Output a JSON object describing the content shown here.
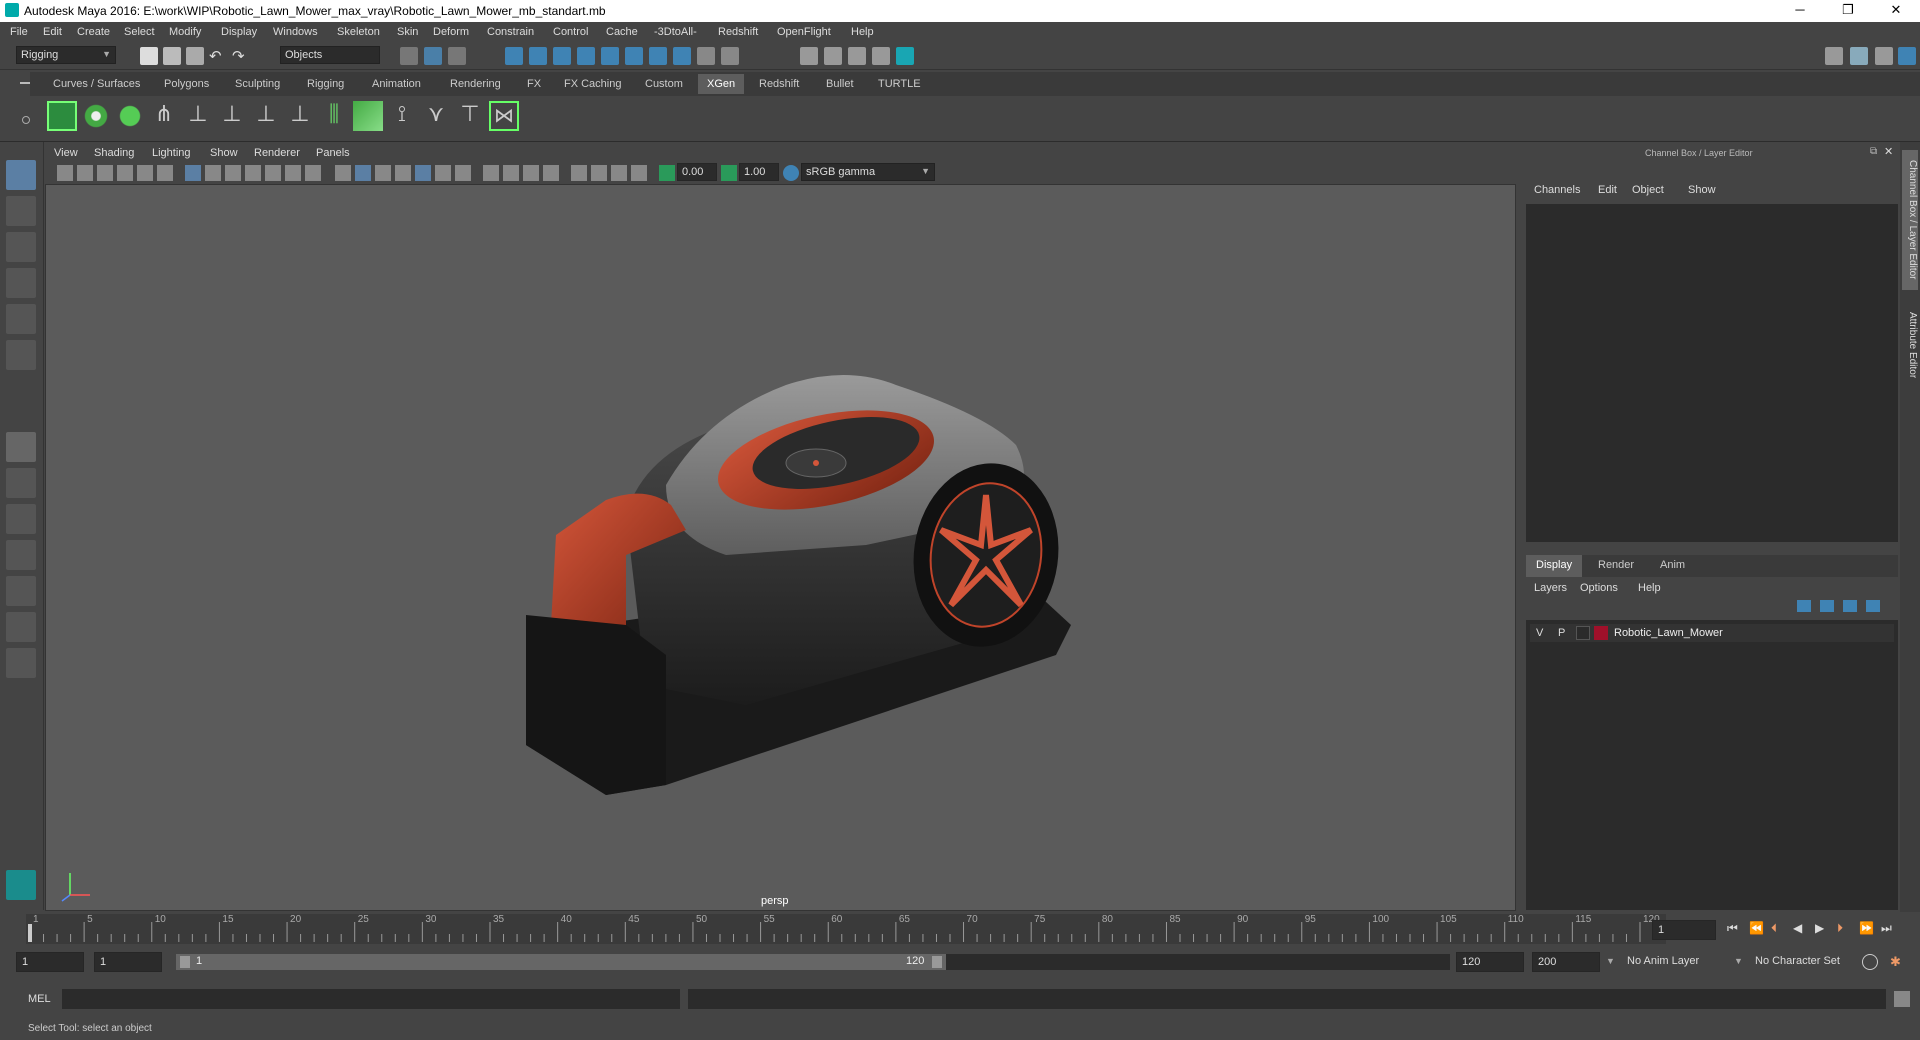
{
  "window": {
    "title": "Autodesk Maya 2016: E:\\work\\WIP\\Robotic_Lawn_Mower_max_vray\\Robotic_Lawn_Mower_mb_standart.mb",
    "minimize": "─",
    "restore": "❐",
    "close": "✕"
  },
  "menubar": [
    "File",
    "Edit",
    "Create",
    "Select",
    "Modify",
    "Display",
    "Windows",
    "Skeleton",
    "Skin",
    "Deform",
    "Constrain",
    "Control",
    "Cache",
    "-3DtoAll-",
    "Redshift",
    "OpenFlight",
    "Help"
  ],
  "statusline": {
    "mode": "Rigging",
    "selection_mode": "Objects"
  },
  "shelf_tabs": [
    "Curves / Surfaces",
    "Polygons",
    "Sculpting",
    "Rigging",
    "Animation",
    "Rendering",
    "FX",
    "FX Caching",
    "Custom",
    "XGen",
    "Redshift",
    "Bullet",
    "TURTLE"
  ],
  "shelf_active": "XGen",
  "viewport": {
    "menu": [
      "View",
      "Shading",
      "Lighting",
      "Show",
      "Renderer",
      "Panels"
    ],
    "exposure": "0.00",
    "gamma": "1.00",
    "color_space": "sRGB gamma",
    "camera": "persp"
  },
  "channel_box": {
    "title": "Channel Box / Layer Editor",
    "menu": [
      "Channels",
      "Edit",
      "Object",
      "Show"
    ]
  },
  "layer_editor": {
    "tabs": [
      "Display",
      "Render",
      "Anim"
    ],
    "active_tab": "Display",
    "menu": [
      "Layers",
      "Options",
      "Help"
    ],
    "layers": [
      {
        "v": "V",
        "p": "P",
        "color": "#a0102a",
        "name": "Robotic_Lawn_Mower"
      }
    ]
  },
  "side_tabs": [
    "Channel Box / Layer Editor",
    "Attribute Editor"
  ],
  "timeline": {
    "ticks": [
      "1",
      "5",
      "10",
      "15",
      "20",
      "25",
      "30",
      "35",
      "40",
      "45",
      "50",
      "55",
      "60",
      "65",
      "70",
      "75",
      "80",
      "85",
      "90",
      "95",
      "100",
      "105",
      "110",
      "115",
      "120"
    ],
    "current_frame": "1"
  },
  "range": {
    "start": "1",
    "start_inner": "1",
    "slider_start": "1",
    "slider_end": "120",
    "end_inner": "120",
    "end": "200",
    "anim_layer": "No Anim Layer",
    "character_set": "No Character Set"
  },
  "cmdline": {
    "label": "MEL"
  },
  "helpline": {
    "text": "Select Tool: select an object"
  }
}
